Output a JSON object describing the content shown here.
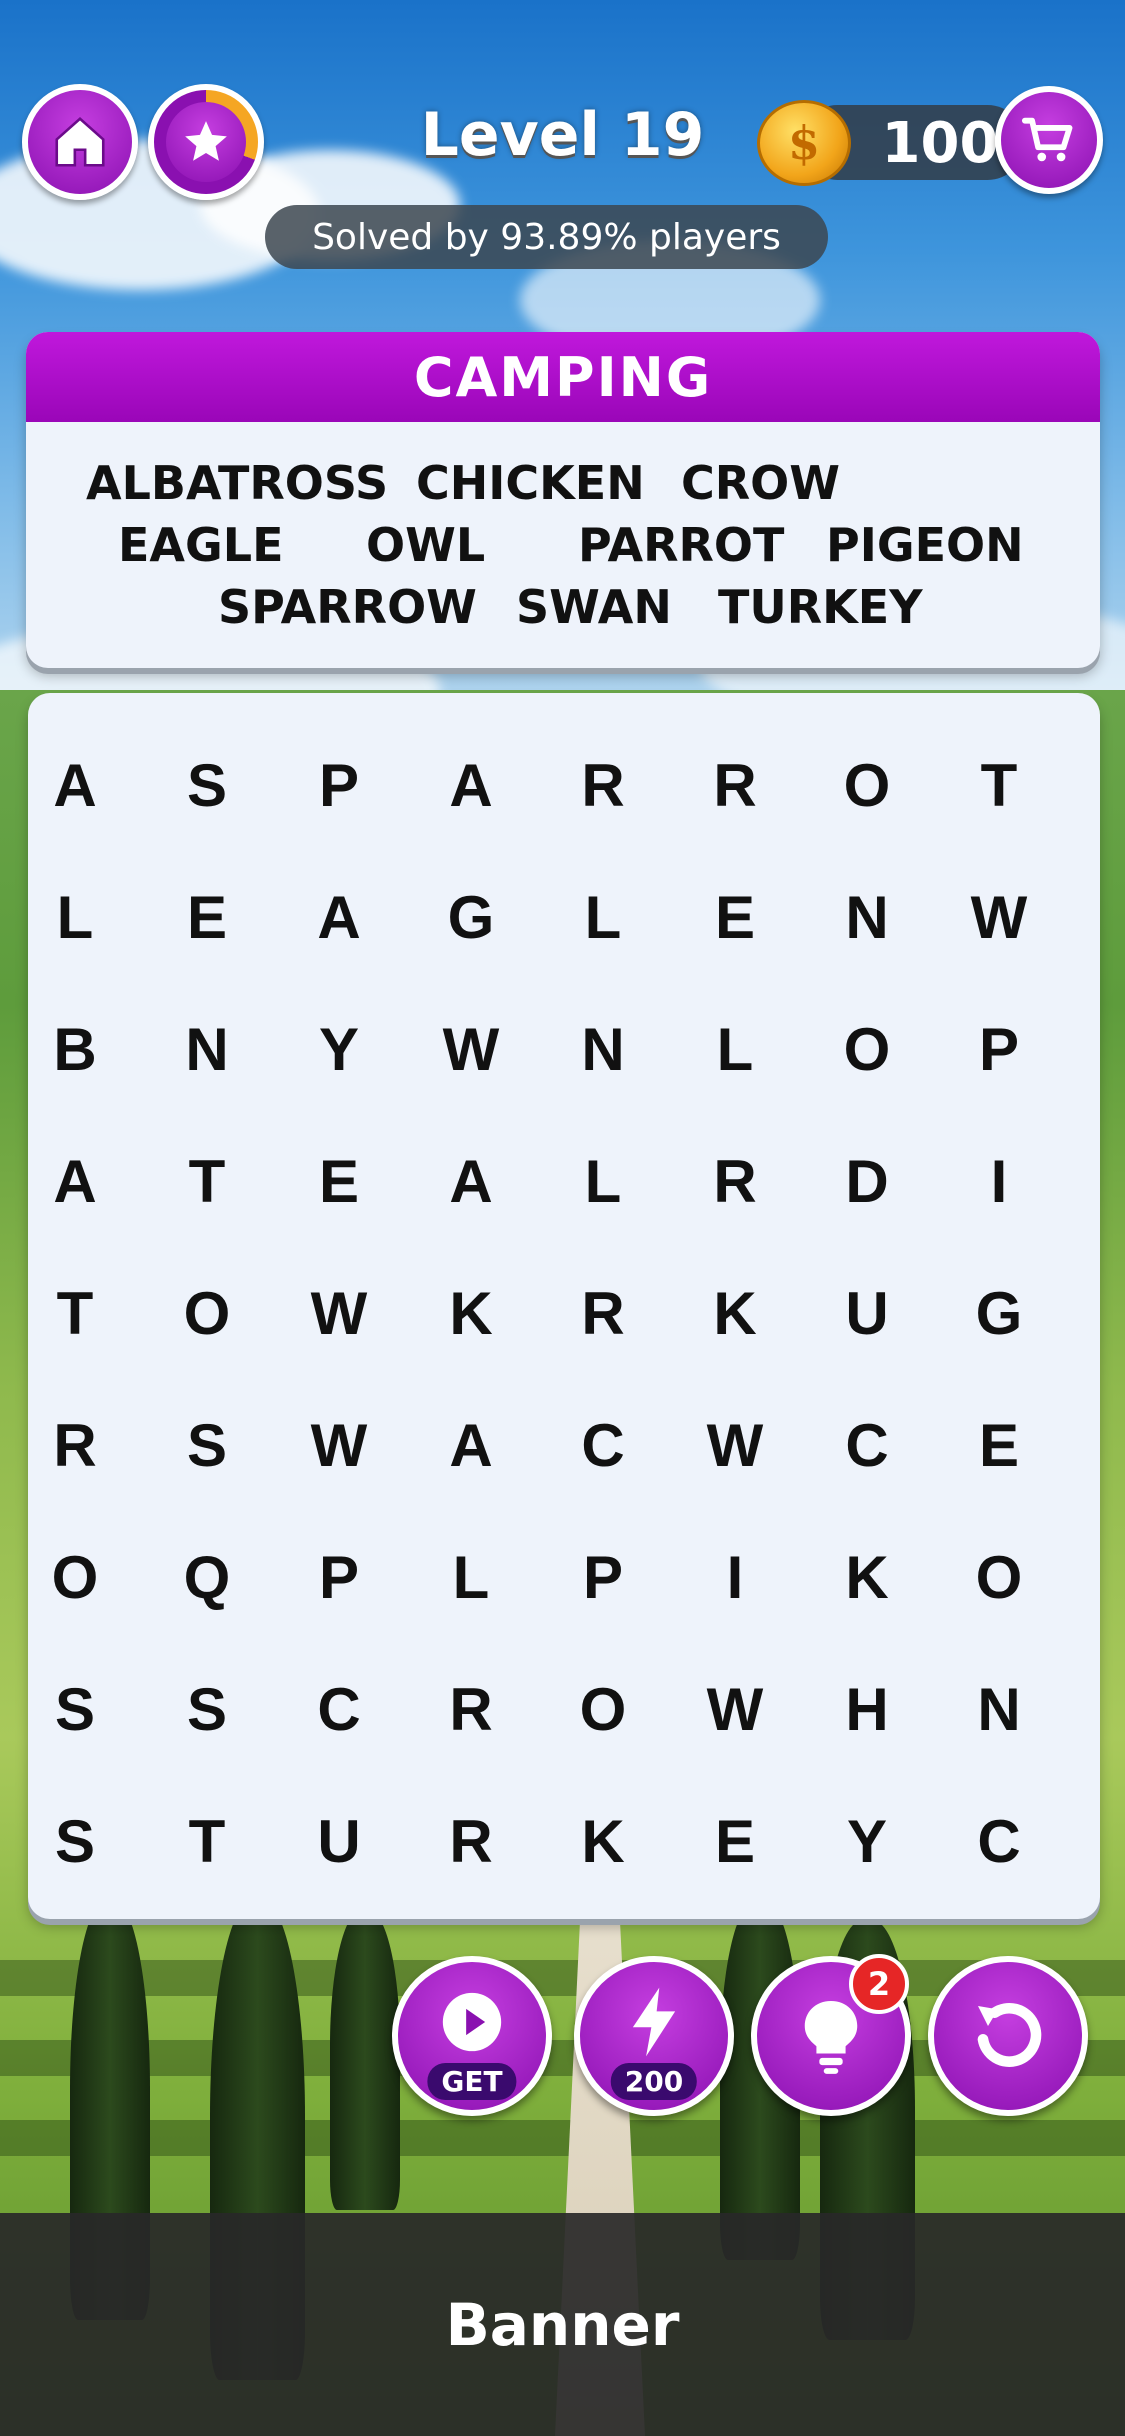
{
  "header": {
    "level": "Level 19",
    "solved_text": "Solved by 93.89% players",
    "coins": "100",
    "coin_symbol": "$"
  },
  "icons": [
    "home-icon",
    "star-icon",
    "coin-icon",
    "cart-icon",
    "play-icon",
    "bolt-icon",
    "lightbulb-icon",
    "undo-icon"
  ],
  "category": {
    "title": "CAMPING",
    "words": [
      "ALBATROSS",
      "CHICKEN",
      "CROW",
      "EAGLE",
      "OWL",
      "PARROT",
      "PIGEON",
      "SPARROW",
      "SWAN",
      "TURKEY"
    ]
  },
  "grid": [
    [
      "A",
      "S",
      "P",
      "A",
      "R",
      "R",
      "O",
      "T"
    ],
    [
      "L",
      "E",
      "A",
      "G",
      "L",
      "E",
      "N",
      "W"
    ],
    [
      "B",
      "N",
      "Y",
      "W",
      "N",
      "L",
      "O",
      "P"
    ],
    [
      "A",
      "T",
      "E",
      "A",
      "L",
      "R",
      "D",
      "I"
    ],
    [
      "T",
      "O",
      "W",
      "K",
      "R",
      "K",
      "U",
      "G"
    ],
    [
      "R",
      "S",
      "W",
      "A",
      "C",
      "W",
      "C",
      "E"
    ],
    [
      "O",
      "Q",
      "P",
      "L",
      "P",
      "I",
      "K",
      "O"
    ],
    [
      "S",
      "S",
      "C",
      "R",
      "O",
      "W",
      "H",
      "N"
    ],
    [
      "S",
      "T",
      "U",
      "R",
      "K",
      "E",
      "Y",
      "C"
    ]
  ],
  "tools": {
    "get_label": "GET",
    "boost_cost": "200",
    "hint_badge": "2"
  },
  "banner": "Banner",
  "colors": {
    "accent": "#9a06b8",
    "panel": "#eef3fb",
    "badge": "#e62626"
  }
}
